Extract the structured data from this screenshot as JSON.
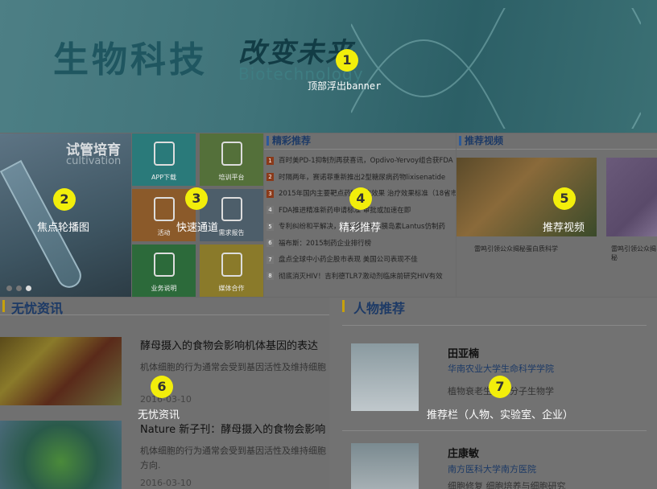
{
  "banner": {
    "title": "生物科技",
    "subtitle": "改变未来",
    "english": "Biotechnology"
  },
  "focus": {
    "title": "试管培育",
    "english": "cultivation"
  },
  "quick": {
    "tiles": [
      {
        "label": "APP下载",
        "color": "#2a7a7a"
      },
      {
        "label": "培训平台",
        "color": "#54703a"
      },
      {
        "label": "活动",
        "color": "#8b5a2a"
      },
      {
        "label": "需求报告",
        "color": "#4d5e6a"
      },
      {
        "label": "业务说明",
        "color": "#2c6a3a"
      },
      {
        "label": "媒体合作",
        "color": "#8a7a2a"
      }
    ]
  },
  "picks": {
    "header": "精彩推荐",
    "items": [
      {
        "no": "1",
        "text": "百时美PD-1抑制剂再获喜讯，Opdivo-Yervoy组合获FDA"
      },
      {
        "no": "2",
        "text": "时隔两年，赛诺菲重新推出2型糖尿病药物lixisenatide"
      },
      {
        "no": "3",
        "text": "2015年国内主要靶点药物治疗效果 治疗效果标准（18省市）"
      },
      {
        "no": "4",
        "text": "FDA推进精准新药申请标准 审批或加速在即"
      },
      {
        "no": "5",
        "text": "专利纠纷和平解决，礼来即将推出胰岛素Lantus仿制药"
      },
      {
        "no": "6",
        "text": "福布斯：2015制药企业排行榜"
      },
      {
        "no": "7",
        "text": "盘点全球中小药企股市表现 美国公司表现不佳"
      },
      {
        "no": "8",
        "text": "彻底消灭HIV！吉利德TLR7激动剂临床前研究HIV有效"
      }
    ]
  },
  "videos": {
    "header": "推荐视频",
    "items": [
      {
        "caption": "雷鸣引领公众揭秘蛋白质科学"
      },
      {
        "caption": "雷鸣引领公众揭秘"
      }
    ]
  },
  "wuyou": {
    "header": "无忧资讯",
    "articles": [
      {
        "title": "酵母摄入的食物会影响机体基因的表达",
        "body": "机体细胞的行为通常会受到基因活性及维持细胞",
        "date": "2016-03-10"
      },
      {
        "title": "Nature 新子刊：酵母摄入的食物会影响",
        "body": "机体细胞的行为通常会受到基因活性及维持细胞方向.",
        "date": "2016-03-10"
      }
    ]
  },
  "people": {
    "header": "人物推荐",
    "items": [
      {
        "name": "田亚楠",
        "org": "华南农业大学生命科学学院",
        "desc": "植物衰老生理与分子生物学"
      },
      {
        "name": "庄康敏",
        "org": "南方医科大学南方医院",
        "desc": "细胞修复 细胞培养与细胞研究"
      }
    ]
  },
  "annotations": [
    {
      "no": "1",
      "label": "顶部浮出banner"
    },
    {
      "no": "2",
      "label": "焦点轮播图"
    },
    {
      "no": "3",
      "label": "快速通道"
    },
    {
      "no": "4",
      "label": "精彩推荐"
    },
    {
      "no": "5",
      "label": "推荐视频"
    },
    {
      "no": "6",
      "label": "无忧资讯"
    },
    {
      "no": "7",
      "label": "推荐栏（人物、实验室、企业）"
    }
  ]
}
